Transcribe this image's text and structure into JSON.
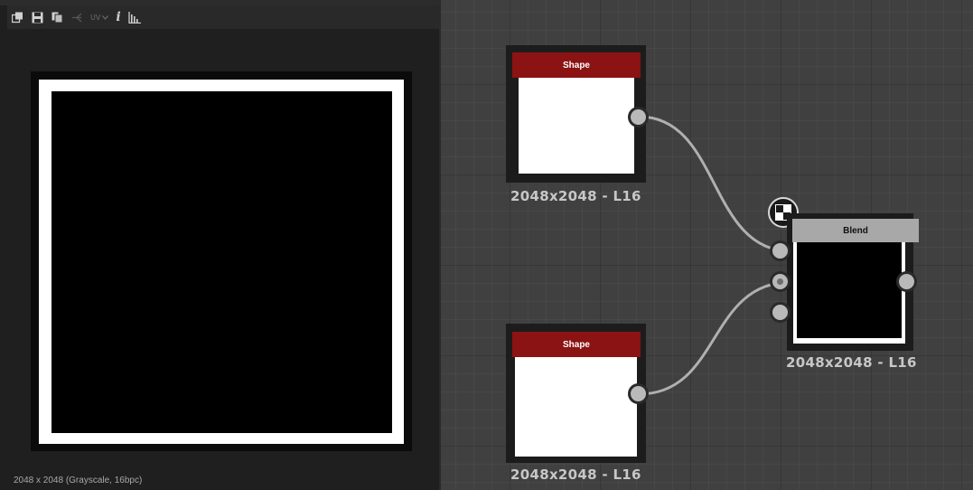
{
  "view2d": {
    "toolbar": {
      "icons": [
        "copy-image-icon",
        "save-icon",
        "layers-icon",
        "tiling-icon",
        "uv-icon",
        "info-icon",
        "histogram-icon"
      ],
      "uv_label": "UV",
      "info_glyph": "i"
    },
    "status": "2048 x 2048 (Grayscale, 16bpc)"
  },
  "graph": {
    "nodes": [
      {
        "id": "shape-1",
        "title": "Shape",
        "resolution": "2048x2048 - L16",
        "header_color": "#8b1313",
        "thumbnail": "white"
      },
      {
        "id": "shape-2",
        "title": "Shape",
        "resolution": "2048x2048 - L16",
        "header_color": "#8b1313",
        "thumbnail": "white"
      },
      {
        "id": "blend",
        "title": "Blend",
        "resolution": "2048x2048 - L16",
        "header_color": "#a8a8a8",
        "thumbnail": "black-with-white-border"
      }
    ],
    "connections": [
      {
        "from": "shape-1.output",
        "to": "blend.input-1"
      },
      {
        "from": "shape-2.output",
        "to": "blend.input-2"
      }
    ],
    "wire_color": "#b0b0b0"
  }
}
